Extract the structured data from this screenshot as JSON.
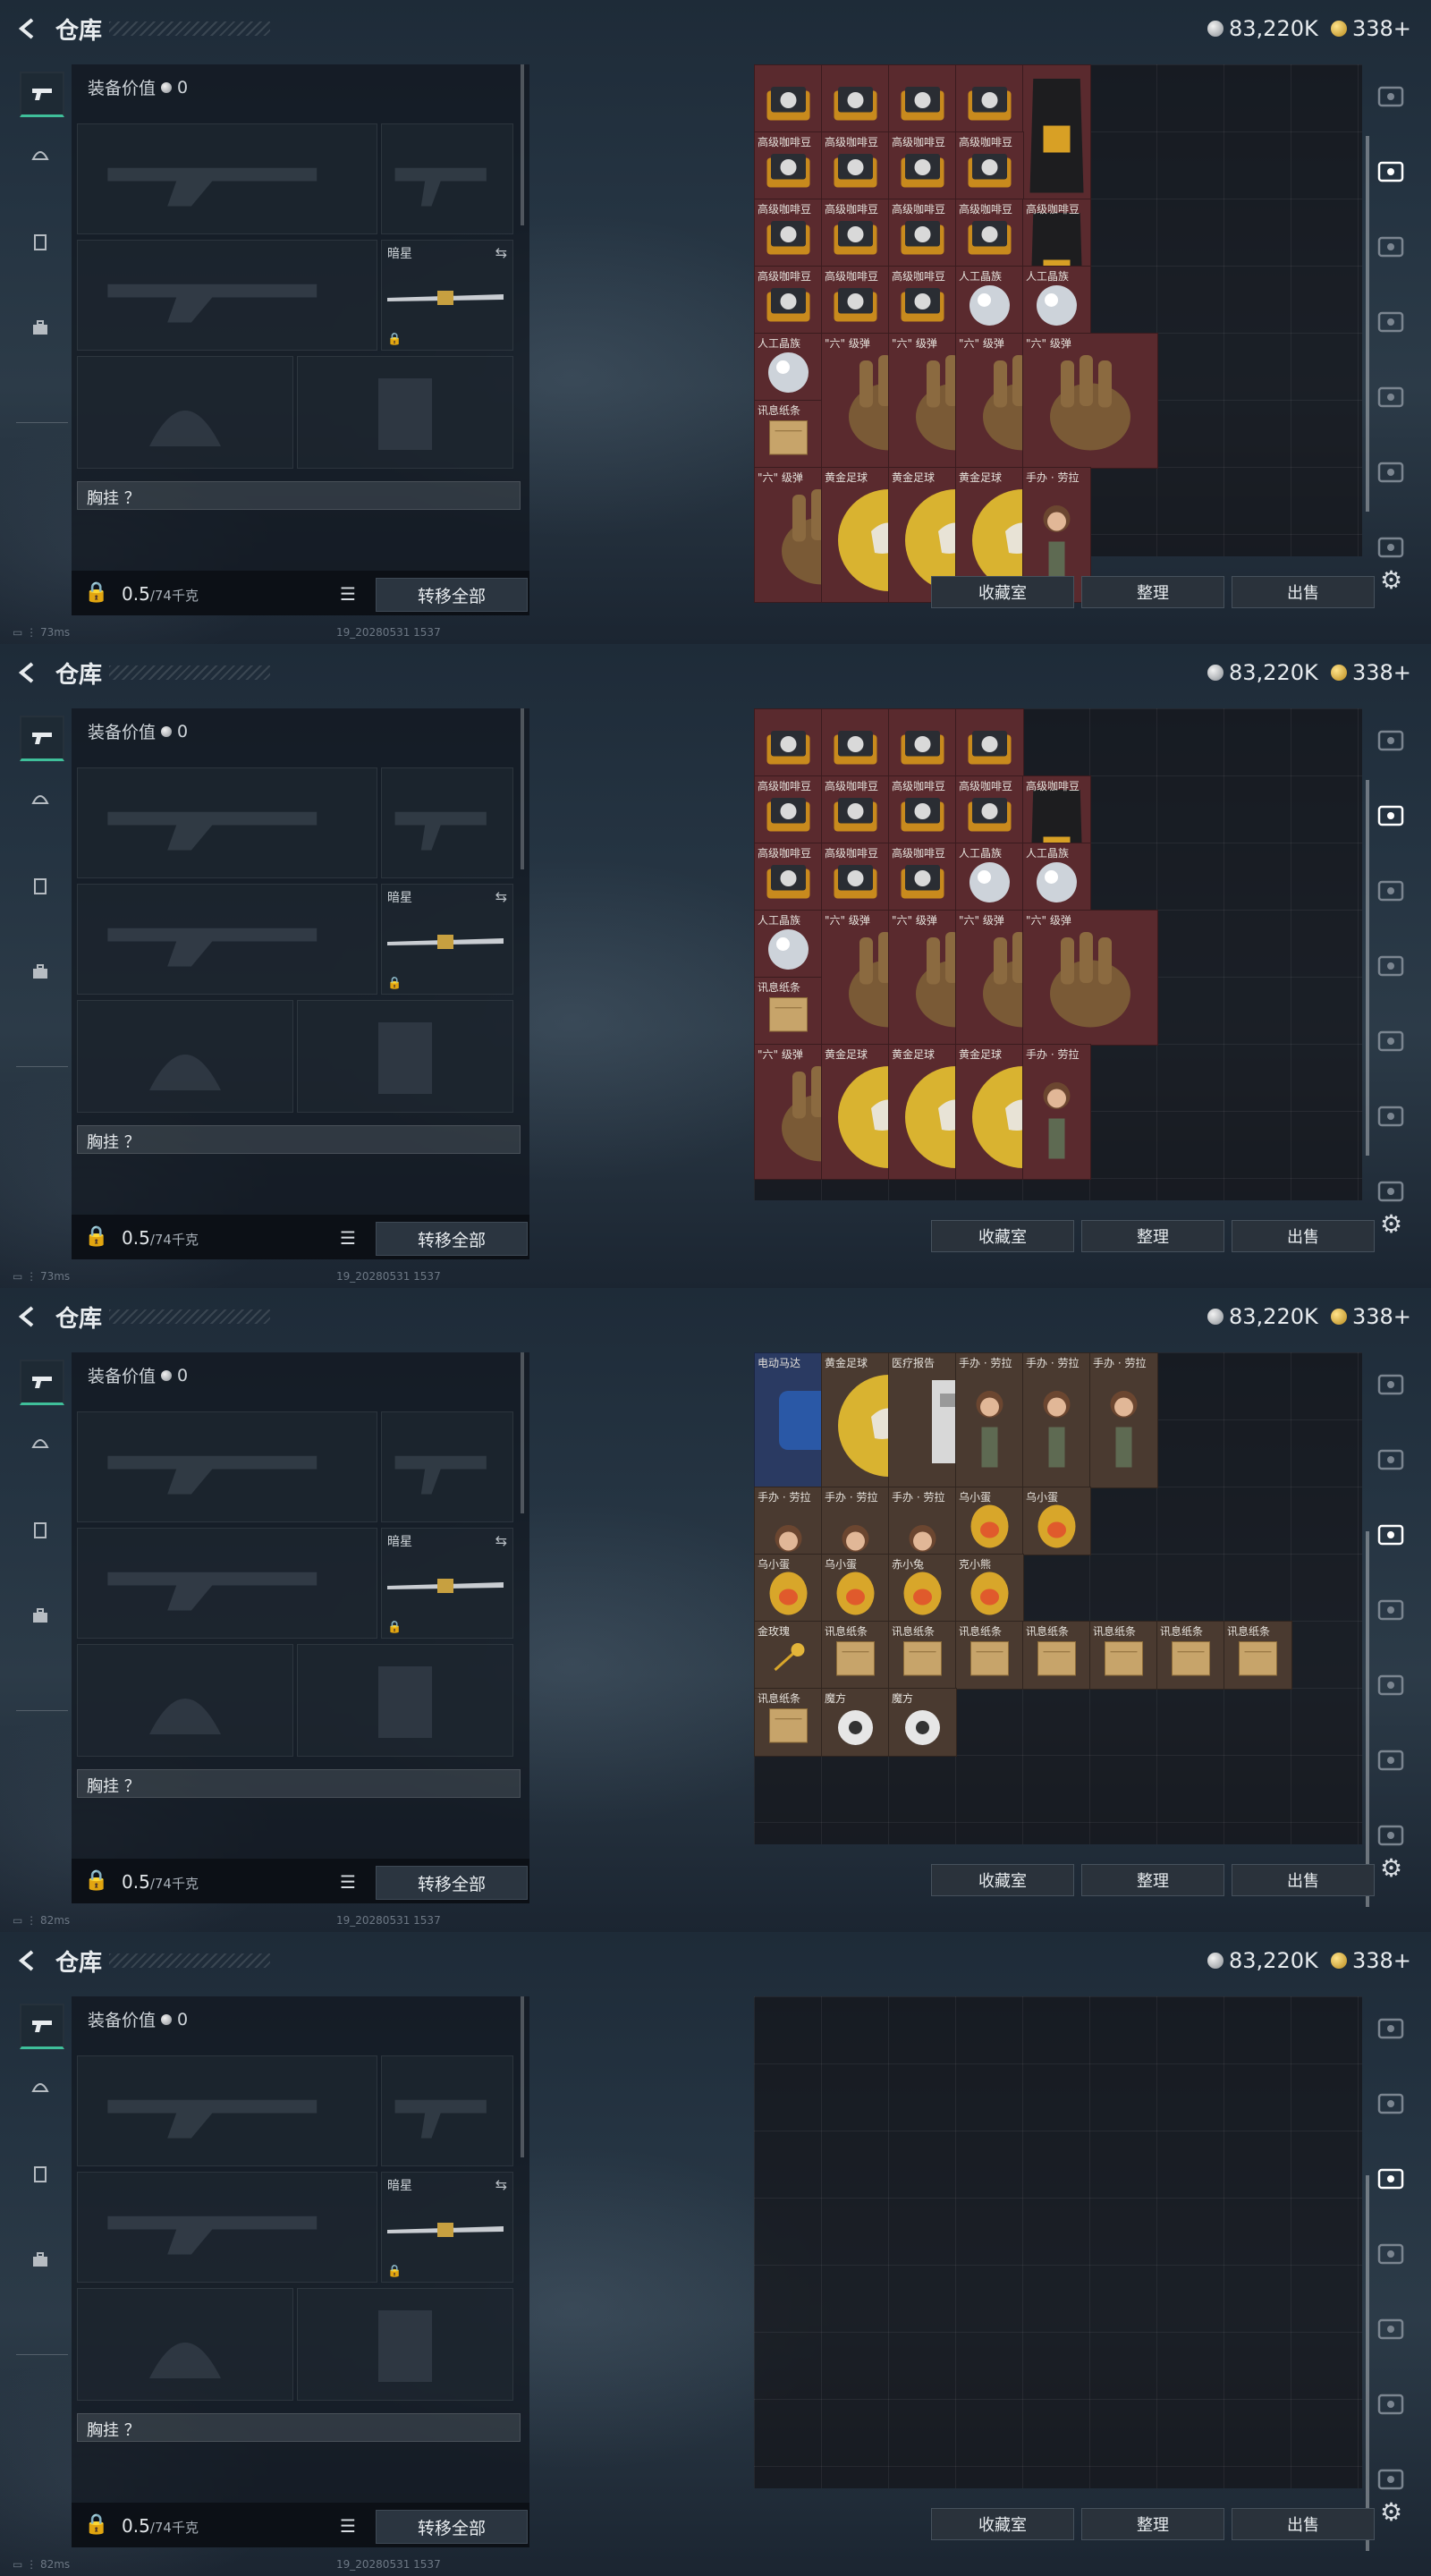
{
  "screens": [
    {
      "title": "仓库",
      "currency": {
        "silver": "83,220K",
        "gold": "338+"
      },
      "equipment": {
        "value_label": "装备价值",
        "value": "0",
        "melee_label": "暗星",
        "chest_label": "胸挂 ？",
        "weight": "0.5",
        "weight_max": "/74千克",
        "transfer_label": "转移全部"
      },
      "status": {
        "ping": "73ms",
        "build": "19_20280531 1537"
      },
      "actions": [
        "收藏室",
        "整理",
        "出售"
      ],
      "items": [
        {
          "label": "",
          "type": "coffee",
          "c": 0,
          "r": 0
        },
        {
          "label": "",
          "type": "coffee",
          "c": 1,
          "r": 0
        },
        {
          "label": "",
          "type": "coffee",
          "c": 2,
          "r": 0
        },
        {
          "label": "",
          "type": "coffee",
          "c": 3,
          "r": 0
        },
        {
          "label": "",
          "type": "bag",
          "c": 4,
          "r": 0
        },
        {
          "label": "高级咖啡豆",
          "type": "coffee",
          "c": 0,
          "r": 1
        },
        {
          "label": "高级咖啡豆",
          "type": "coffee",
          "c": 1,
          "r": 1
        },
        {
          "label": "高级咖啡豆",
          "type": "coffee",
          "c": 2,
          "r": 1
        },
        {
          "label": "高级咖啡豆",
          "type": "coffee",
          "c": 3,
          "r": 1
        },
        {
          "label": "高级咖啡豆",
          "type": "coffee",
          "c": 0,
          "r": 2
        },
        {
          "label": "高级咖啡豆",
          "type": "coffee",
          "c": 1,
          "r": 2
        },
        {
          "label": "高级咖啡豆",
          "type": "coffee",
          "c": 2,
          "r": 2
        },
        {
          "label": "高级咖啡豆",
          "type": "coffee",
          "c": 3,
          "r": 2
        },
        {
          "label": "高级咖啡豆",
          "type": "bag",
          "c": 4,
          "r": 2
        },
        {
          "label": "高级咖啡豆",
          "type": "coffee",
          "c": 0,
          "r": 3
        },
        {
          "label": "高级咖啡豆",
          "type": "coffee",
          "c": 1,
          "r": 3
        },
        {
          "label": "高级咖啡豆",
          "type": "coffee",
          "c": 2,
          "r": 3
        },
        {
          "label": "人工晶族",
          "type": "crystal",
          "c": 3,
          "r": 3
        },
        {
          "label": "人工晶族",
          "type": "crystal",
          "c": 4,
          "r": 3
        },
        {
          "label": "人工晶族",
          "type": "crystal",
          "c": 0,
          "r": 4
        },
        {
          "label": "讯息纸条",
          "type": "note",
          "c": 0,
          "r": 5
        },
        {
          "label": "\"六\" 级弹",
          "type": "hand",
          "c": 1,
          "r": 4
        },
        {
          "label": "\"六\" 级弹",
          "type": "hand",
          "c": 2,
          "r": 4
        },
        {
          "label": "\"六\" 级弹",
          "type": "hand",
          "c": 3,
          "r": 4
        },
        {
          "label": "\"六\" 级弹",
          "type": "hand",
          "c": 4,
          "r": 4
        },
        {
          "label": "\"六\" 级弹",
          "type": "hand",
          "c": 0,
          "r": 6
        },
        {
          "label": "黄金足球",
          "type": "ball",
          "c": 1,
          "r": 6
        },
        {
          "label": "黄金足球",
          "type": "ball",
          "c": 2,
          "r": 6
        },
        {
          "label": "黄金足球",
          "type": "ball",
          "c": 3,
          "r": 6
        },
        {
          "label": "手办 · 劳拉",
          "type": "figure",
          "c": 4,
          "r": 6
        }
      ]
    },
    {
      "title": "仓库",
      "currency": {
        "silver": "83,220K",
        "gold": "338+"
      },
      "equipment": {
        "value_label": "装备价值",
        "value": "0",
        "melee_label": "暗星",
        "chest_label": "胸挂 ？",
        "weight": "0.5",
        "weight_max": "/74千克",
        "transfer_label": "转移全部"
      },
      "status": {
        "ping": "73ms",
        "build": "19_20280531 1537"
      },
      "actions": [
        "收藏室",
        "整理",
        "出售"
      ],
      "items": [
        {
          "label": "",
          "type": "coffee",
          "c": 0,
          "r": 0
        },
        {
          "label": "",
          "type": "coffee",
          "c": 1,
          "r": 0
        },
        {
          "label": "",
          "type": "coffee",
          "c": 2,
          "r": 0
        },
        {
          "label": "",
          "type": "coffee",
          "c": 3,
          "r": 0
        },
        {
          "label": "高级咖啡豆",
          "type": "coffee",
          "c": 0,
          "r": 1
        },
        {
          "label": "高级咖啡豆",
          "type": "coffee",
          "c": 1,
          "r": 1
        },
        {
          "label": "高级咖啡豆",
          "type": "coffee",
          "c": 2,
          "r": 1
        },
        {
          "label": "高级咖啡豆",
          "type": "coffee",
          "c": 3,
          "r": 1
        },
        {
          "label": "高级咖啡豆",
          "type": "bag",
          "c": 4,
          "r": 1
        },
        {
          "label": "高级咖啡豆",
          "type": "coffee",
          "c": 0,
          "r": 2
        },
        {
          "label": "高级咖啡豆",
          "type": "coffee",
          "c": 1,
          "r": 2
        },
        {
          "label": "高级咖啡豆",
          "type": "coffee",
          "c": 2,
          "r": 2
        },
        {
          "label": "人工晶族",
          "type": "crystal",
          "c": 3,
          "r": 2
        },
        {
          "label": "人工晶族",
          "type": "crystal",
          "c": 4,
          "r": 2
        },
        {
          "label": "人工晶族",
          "type": "crystal",
          "c": 0,
          "r": 3
        },
        {
          "label": "讯息纸条",
          "type": "note",
          "c": 0,
          "r": 4
        },
        {
          "label": "\"六\" 级弹",
          "type": "hand",
          "c": 1,
          "r": 3
        },
        {
          "label": "\"六\" 级弹",
          "type": "hand",
          "c": 2,
          "r": 3
        },
        {
          "label": "\"六\" 级弹",
          "type": "hand",
          "c": 3,
          "r": 3
        },
        {
          "label": "\"六\" 级弹",
          "type": "hand",
          "c": 4,
          "r": 3
        },
        {
          "label": "\"六\" 级弹",
          "type": "hand",
          "c": 0,
          "r": 5
        },
        {
          "label": "黄金足球",
          "type": "ball",
          "c": 1,
          "r": 5
        },
        {
          "label": "黄金足球",
          "type": "ball",
          "c": 2,
          "r": 5
        },
        {
          "label": "黄金足球",
          "type": "ball",
          "c": 3,
          "r": 5
        },
        {
          "label": "手办 · 劳拉",
          "type": "figure",
          "c": 4,
          "r": 5
        }
      ]
    },
    {
      "title": "仓库",
      "currency": {
        "silver": "83,220K",
        "gold": "338+"
      },
      "equipment": {
        "value_label": "装备价值",
        "value": "0",
        "melee_label": "暗星",
        "chest_label": "胸挂 ？",
        "weight": "0.5",
        "weight_max": "/74千克",
        "transfer_label": "转移全部"
      },
      "status": {
        "ping": "82ms",
        "build": "19_20280531 1537"
      },
      "actions": [
        "收藏室",
        "整理",
        "出售"
      ],
      "items": [
        {
          "label": "电动马达",
          "type": "motor",
          "c": 0,
          "r": 0
        },
        {
          "label": "黄金足球",
          "type": "ball",
          "c": 1,
          "r": 0
        },
        {
          "label": "医疗报告",
          "type": "report",
          "c": 2,
          "r": 0
        },
        {
          "label": "手办 · 劳拉",
          "type": "figure",
          "c": 3,
          "r": 0
        },
        {
          "label": "手办 · 劳拉",
          "type": "figure",
          "c": 4,
          "r": 0
        },
        {
          "label": "手办 · 劳拉",
          "type": "figure",
          "c": 5,
          "r": 0
        },
        {
          "label": "手办 · 劳拉",
          "type": "figure",
          "c": 0,
          "r": 2
        },
        {
          "label": "手办 · 劳拉",
          "type": "figure",
          "c": 1,
          "r": 2
        },
        {
          "label": "手办 · 劳拉",
          "type": "figure",
          "c": 2,
          "r": 2
        },
        {
          "label": "乌小蛋",
          "type": "egg",
          "c": 3,
          "r": 2
        },
        {
          "label": "乌小蛋",
          "type": "egg",
          "c": 4,
          "r": 2
        },
        {
          "label": "乌小蛋",
          "type": "egg",
          "c": 0,
          "r": 3
        },
        {
          "label": "乌小蛋",
          "type": "egg",
          "c": 1,
          "r": 3
        },
        {
          "label": "赤小兔",
          "type": "egg",
          "c": 2,
          "r": 3
        },
        {
          "label": "克小熊",
          "type": "egg",
          "c": 3,
          "r": 3
        },
        {
          "label": "金玫瑰",
          "type": "rose",
          "c": 0,
          "r": 4
        },
        {
          "label": "讯息纸条",
          "type": "note",
          "c": 1,
          "r": 4
        },
        {
          "label": "讯息纸条",
          "type": "note",
          "c": 2,
          "r": 4
        },
        {
          "label": "讯息纸条",
          "type": "note",
          "c": 3,
          "r": 4
        },
        {
          "label": "讯息纸条",
          "type": "note",
          "c": 4,
          "r": 4
        },
        {
          "label": "讯息纸条",
          "type": "note",
          "c": 5,
          "r": 4
        },
        {
          "label": "讯息纸条",
          "type": "note",
          "c": 6,
          "r": 4
        },
        {
          "label": "讯息纸条",
          "type": "note",
          "c": 7,
          "r": 4
        },
        {
          "label": "讯息纸条",
          "type": "note",
          "c": 0,
          "r": 5
        },
        {
          "label": "魔方",
          "type": "cube",
          "c": 1,
          "r": 5
        },
        {
          "label": "魔方",
          "type": "cube",
          "c": 2,
          "r": 5
        }
      ]
    },
    {
      "title": "仓库",
      "currency": {
        "silver": "83,220K",
        "gold": "338+"
      },
      "equipment": {
        "value_label": "装备价值",
        "value": "0",
        "melee_label": "暗星",
        "chest_label": "胸挂 ？",
        "weight": "0.5",
        "weight_max": "/74千克",
        "transfer_label": "转移全部"
      },
      "status": {
        "ping": "82ms",
        "build": "19_20280531 1537"
      },
      "actions": [
        "收藏室",
        "整理",
        "出售"
      ],
      "items": []
    }
  ],
  "colors": {
    "item_red": "#5a2a2e",
    "item_brown": "#4a3a30",
    "accent": "#3fbf9a"
  }
}
